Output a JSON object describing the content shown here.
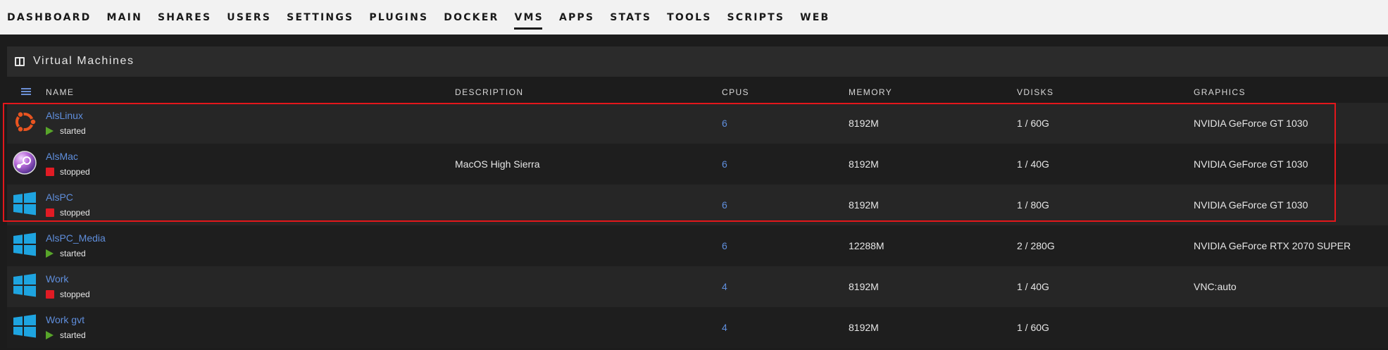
{
  "nav": {
    "items": [
      "DASHBOARD",
      "MAIN",
      "SHARES",
      "USERS",
      "SETTINGS",
      "PLUGINS",
      "DOCKER",
      "VMS",
      "APPS",
      "STATS",
      "TOOLS",
      "SCRIPTS",
      "WEB"
    ],
    "active": "VMS"
  },
  "panel": {
    "title": "Virtual Machines",
    "columns": {
      "name": "NAME",
      "description": "DESCRIPTION",
      "cpus": "CPUS",
      "memory": "MEMORY",
      "vdisks": "VDISKS",
      "graphics": "GRAPHICS"
    }
  },
  "vms": [
    {
      "name": "AlsLinux",
      "state": "started",
      "os": "ubuntu-icon",
      "description": "",
      "cpus": "6",
      "memory": "8192M",
      "vdisks": "1 / 60G",
      "graphics": "NVIDIA GeForce GT 1030"
    },
    {
      "name": "AlsMac",
      "state": "stopped",
      "os": "macos-icon",
      "description": "MacOS High Sierra",
      "cpus": "6",
      "memory": "8192M",
      "vdisks": "1 / 40G",
      "graphics": "NVIDIA GeForce GT 1030"
    },
    {
      "name": "AlsPC",
      "state": "stopped",
      "os": "windows-icon",
      "description": "",
      "cpus": "6",
      "memory": "8192M",
      "vdisks": "1 / 80G",
      "graphics": "NVIDIA GeForce GT 1030"
    },
    {
      "name": "AlsPC_Media",
      "state": "started",
      "os": "windows-icon",
      "description": "",
      "cpus": "6",
      "memory": "12288M",
      "vdisks": "2 / 280G",
      "graphics": "NVIDIA GeForce RTX 2070 SUPER"
    },
    {
      "name": "Work",
      "state": "stopped",
      "os": "windows-icon",
      "description": "",
      "cpus": "4",
      "memory": "8192M",
      "vdisks": "1 / 40G",
      "graphics": "VNC:auto"
    },
    {
      "name": "Work gvt",
      "state": "started",
      "os": "windows-icon",
      "description": "",
      "cpus": "4",
      "memory": "8192M",
      "vdisks": "1 / 60G",
      "graphics": ""
    }
  ],
  "colors": {
    "link": "#5f8edc",
    "started": "#58a52a",
    "stopped": "#e01b24",
    "highlight": "#e3171b",
    "windows": "#1ea4e0",
    "ubuntu": "#e95420"
  }
}
